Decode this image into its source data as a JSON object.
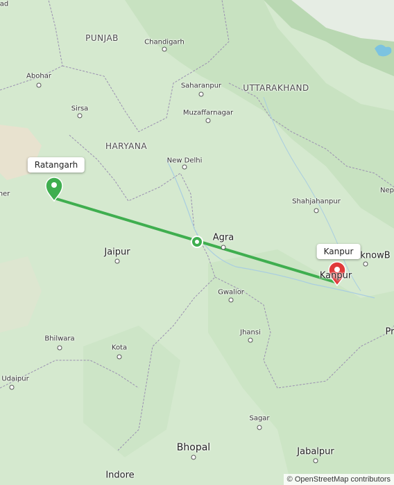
{
  "map": {
    "states": [
      {
        "id": "punjab",
        "name": "PUNJAB"
      },
      {
        "id": "haryana",
        "name": "HARYANA"
      },
      {
        "id": "uttarakhand",
        "name": "UTTARAKHAND"
      }
    ],
    "cities": [
      {
        "id": "chandigarh",
        "name": "Chandigarh"
      },
      {
        "id": "abohar",
        "name": "Abohar"
      },
      {
        "id": "sirsa",
        "name": "Sirsa"
      },
      {
        "id": "saharanpur",
        "name": "Saharanpur"
      },
      {
        "id": "muzaffarnagar",
        "name": "Muzaffarnagar"
      },
      {
        "id": "new-delhi",
        "name": "New Delhi"
      },
      {
        "id": "shahjahanpur",
        "name": "Shahjahanpur"
      },
      {
        "id": "agra",
        "name": "Agra"
      },
      {
        "id": "jaipur",
        "name": "Jaipur"
      },
      {
        "id": "lucknow",
        "name": "knowB"
      },
      {
        "id": "gwalior",
        "name": "Gwalior"
      },
      {
        "id": "jhansi",
        "name": "Jhansi"
      },
      {
        "id": "bhilwara",
        "name": "Bhilwara"
      },
      {
        "id": "kota",
        "name": "Kota"
      },
      {
        "id": "udaipur",
        "name": "Udaipur"
      },
      {
        "id": "sagar",
        "name": "Sagar"
      },
      {
        "id": "bhopal",
        "name": "Bhopal"
      },
      {
        "id": "jabalpur",
        "name": "Jabalpur"
      },
      {
        "id": "indore",
        "name": "Indore"
      }
    ],
    "edge_fragments": {
      "top_left": "ad",
      "left": "ner",
      "right_nep": "Nep",
      "right_p": "Pr"
    },
    "route": {
      "origin": "Ratangarh",
      "destination": "Kanpur",
      "route_color": "#3fae4f",
      "origin_color": "#3fae4f",
      "destination_color": "#e03a3a"
    }
  },
  "attribution": "© OpenStreetMap contributors"
}
